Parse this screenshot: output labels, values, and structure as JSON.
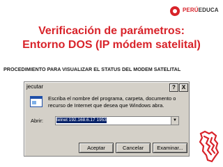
{
  "logo": {
    "prefix": "PERÚ",
    "suffix": "EDUCA"
  },
  "slide": {
    "title_line1": "Verificación de parámetros:",
    "title_line2": "Entorno DOS  (IP módem satelital)",
    "subtitle": "PROCEDIMIENTO PARA  VISUALIZAR  EL STATUS DEL MODEM SATELITAL"
  },
  "run_dialog": {
    "title": "jecutar",
    "help_button": "?",
    "close_button": "X",
    "description": "Escriba el nombre del programa, carpeta, documento o recurso de Internet que desea que Windows abra.",
    "open_label": "Abrir:",
    "open_value": "telnet  192.168.6.17 1953",
    "ok_label": "Aceptar",
    "cancel_label": "Cancelar",
    "browse_label": "Examinar..."
  },
  "colors": {
    "accent": "#d8232a",
    "selection": "#0a246a",
    "dialog_face": "#d4d0c8"
  },
  "icons": [
    "peru-educa-logo-icon",
    "run-program-icon",
    "dropdown-arrow-icon",
    "peru-map-icon"
  ]
}
